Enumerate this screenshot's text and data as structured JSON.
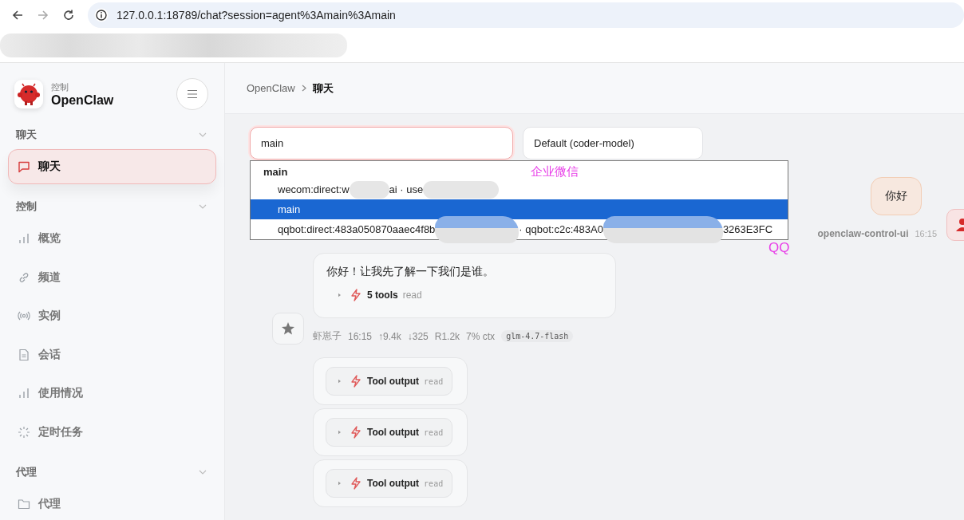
{
  "browser": {
    "url": "127.0.0.1:18789/chat?session=agent%3Amain%3Amain"
  },
  "sidebar": {
    "brand_caption": "控制",
    "brand_name": "OpenClaw",
    "groups": [
      {
        "label": "聊天",
        "expanded": true,
        "items": [
          {
            "label": "聊天",
            "kind": "chat",
            "selected": true
          }
        ]
      },
      {
        "label": "控制",
        "expanded": true,
        "items": [
          {
            "label": "概览",
            "kind": "bars",
            "selected": false
          },
          {
            "label": "频道",
            "kind": "link",
            "selected": false
          },
          {
            "label": "实例",
            "kind": "radio",
            "selected": false
          },
          {
            "label": "会话",
            "kind": "file",
            "selected": false
          },
          {
            "label": "使用情况",
            "kind": "bars",
            "selected": false
          },
          {
            "label": "定时任务",
            "kind": "spinner",
            "selected": false
          }
        ]
      },
      {
        "label": "代理",
        "expanded": true,
        "items": [
          {
            "label": "代理",
            "kind": "folder",
            "selected": false
          }
        ]
      }
    ]
  },
  "breadcrumb": [
    "OpenClaw",
    "聊天"
  ],
  "session_select": {
    "value": "main",
    "focused": true
  },
  "model_select": {
    "value": "Default (coder-model)"
  },
  "session_dropdown": {
    "group": "main",
    "options": [
      {
        "segments": [
          "wecom:direct:w",
          "ai · use"
        ],
        "redacted_end": true,
        "selected": false
      },
      {
        "segments": [
          "main"
        ],
        "redacted_end": false,
        "selected": true
      },
      {
        "segments": [
          "qqbot:direct:483a050870aaec4f8b",
          "· qqbot:c2c:483A0",
          "3263E3FC"
        ],
        "redacted_end": false,
        "selected": false
      }
    ]
  },
  "messages": [
    {
      "kind": "user",
      "text": "你好",
      "sender": "openclaw-control-ui",
      "time": "16:15"
    },
    {
      "kind": "assistant",
      "text": "你好！让我先了解一下我们是谁。",
      "tools_summary": {
        "label": "5 tools",
        "tool": "read"
      },
      "sender": "虾崽子",
      "time": "16:15",
      "stats": [
        "↑9.4k",
        "↓325",
        "R1.2k",
        "7% ctx"
      ],
      "model": "glm-4.7-flash"
    }
  ],
  "tool_outputs": [
    {
      "label": "Tool output",
      "tool": "read"
    },
    {
      "label": "Tool output",
      "tool": "read"
    },
    {
      "label": "Tool output",
      "tool": "read"
    }
  ],
  "annotations": [
    {
      "text": "企业微信",
      "color": "#e83ee8"
    },
    {
      "text": "QQ",
      "color": "#e83ee8"
    }
  ]
}
